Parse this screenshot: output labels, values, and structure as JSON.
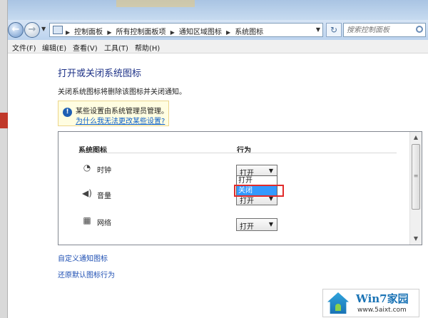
{
  "address": {
    "crumbs": [
      "控制面板",
      "所有控制面板项",
      "通知区域图标",
      "系统图标"
    ],
    "search_placeholder": "搜索控制面板"
  },
  "menu": [
    "文件(F)",
    "编辑(E)",
    "查看(V)",
    "工具(T)",
    "帮助(H)"
  ],
  "page": {
    "title": "打开或关闭系统图标",
    "subtitle": "关闭系统图标将删除该图标并关闭通知。"
  },
  "notice": {
    "text": "某些设置由系统管理员管理。",
    "link": "为什么我无法更改某些设置?"
  },
  "table": {
    "col_icon": "系统图标",
    "col_behavior": "行为",
    "rows": [
      {
        "icon": "clock-icon",
        "label": "时钟",
        "value": "打开"
      },
      {
        "icon": "volume-icon",
        "label": "音量",
        "value": "打开"
      },
      {
        "icon": "network-icon",
        "label": "网络",
        "value": "打开"
      }
    ],
    "dropdown_options": [
      "打开",
      "关闭"
    ],
    "highlighted_option": "关闭"
  },
  "links": {
    "customize": "自定义通知图标",
    "restore": "还原默认图标行为"
  },
  "watermark": {
    "title": "Win7家园",
    "url": "www.5aixt.com"
  },
  "colors": {
    "title_blue": "#1e3287",
    "link_blue": "#1e4fb3",
    "highlight": "#3399ff",
    "annotation_red": "#e12b2b"
  }
}
